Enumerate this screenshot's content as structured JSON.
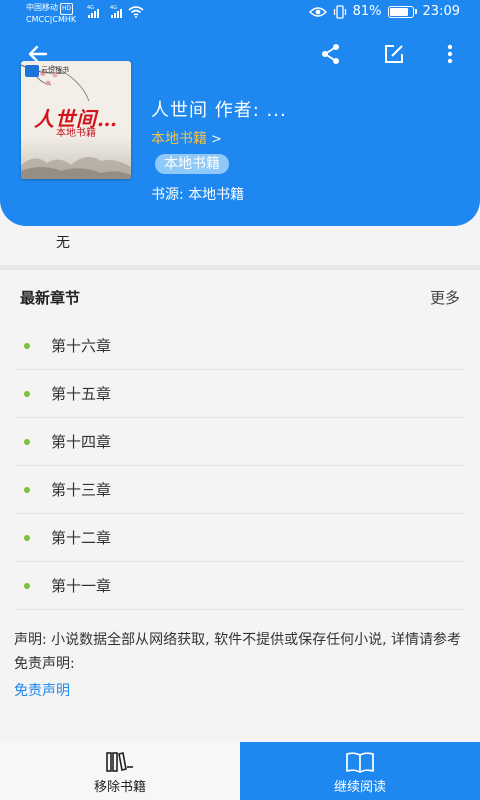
{
  "status_bar": {
    "carrier_line1": "中国移动",
    "carrier_badge": "HD",
    "carrier_line2": "CMCC|CMHK",
    "network1": "4G",
    "network2": "4G",
    "battery_percent": "81%",
    "time": "23:09"
  },
  "toolbar": {
    "back_icon": "arrow-left",
    "share_icon": "share",
    "edit_icon": "edit",
    "more_icon": "more-vertical"
  },
  "book": {
    "cover_brand": "云悦搜书",
    "cover_title": "人世间…",
    "cover_subtitle": "本地书籍",
    "title_line": "人世间 作者: ...",
    "origin": "本地书籍",
    "origin_chevron": ">",
    "tag": "本地书籍",
    "source": "书源: 本地书籍",
    "intro": "无"
  },
  "latest": {
    "title": "最新章节",
    "more": "更多",
    "chapters": [
      {
        "label": "第十六章"
      },
      {
        "label": "第十五章"
      },
      {
        "label": "第十四章"
      },
      {
        "label": "第十三章"
      },
      {
        "label": "第十二章"
      },
      {
        "label": "第十一章"
      }
    ]
  },
  "notice": {
    "text": "声明: 小说数据全部从网络获取, 软件不提供或保存任何小说, 详情请参考免责声明:",
    "link": "免责声明"
  },
  "bottom": {
    "remove_label": "移除书籍",
    "continue_label": "继续阅读"
  },
  "colors": {
    "primary": "#1e88f0",
    "origin_text": "#f5c14a",
    "tag_bg": "#8fc9f7",
    "dot": "#7bbf3a"
  }
}
